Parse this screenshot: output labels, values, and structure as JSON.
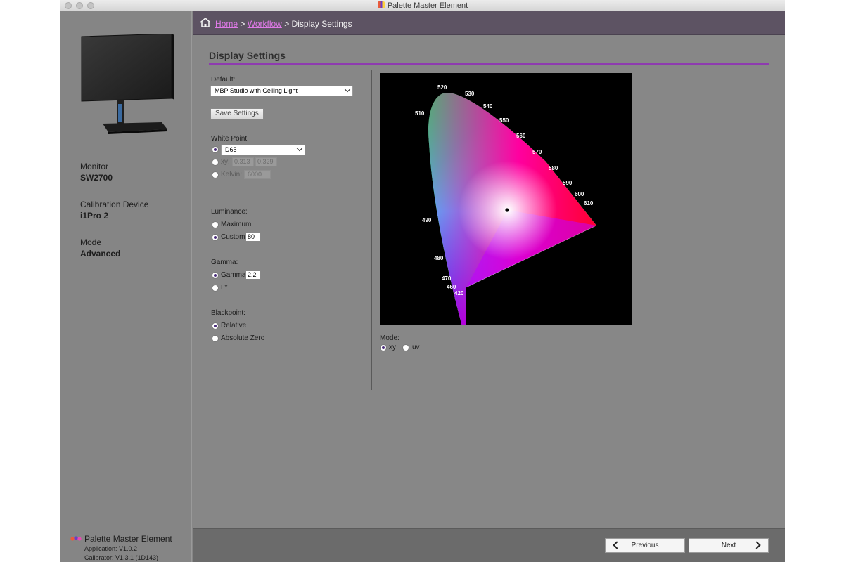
{
  "window": {
    "title": "Palette Master Element"
  },
  "breadcrumb": {
    "home": "Home",
    "workflow": "Workflow",
    "current": "Display Settings",
    "separator": ">"
  },
  "sidebar": {
    "monitor_label": "Monitor",
    "monitor_value": "SW2700",
    "device_label": "Calibration Device",
    "device_value": "i1Pro 2",
    "mode_label": "Mode",
    "mode_value": "Advanced",
    "brand_name": "Palette Master Element",
    "application_version": "Application: V1.0.2",
    "calibrator_version": "Calibrator: V1.3.1 (1D143)"
  },
  "main": {
    "page_title": "Display Settings",
    "default_label": "Default:",
    "default_value": "MBP Studio with Ceiling Light",
    "save_settings_label": "Save Settings",
    "white_point": {
      "label": "White Point:",
      "preset_value": "D65",
      "xy_label": "xy:",
      "x_value": "0.313",
      "y_value": "0.329",
      "kelvin_label": "Kelvin:",
      "kelvin_value": "6000",
      "selected": "preset"
    },
    "luminance": {
      "label": "Luminance:",
      "maximum_label": "Maximum",
      "custom_label": "Custom",
      "custom_value": "80",
      "selected": "custom"
    },
    "gamma": {
      "label": "Gamma:",
      "gamma_label": "Gamma",
      "gamma_value": "2.2",
      "lstar_label": "L*",
      "selected": "gamma"
    },
    "blackpoint": {
      "label": "Blackpoint:",
      "relative_label": "Relative",
      "absolute_label": "Absolute Zero",
      "selected": "relative"
    },
    "diagram": {
      "mode_label": "Mode:",
      "xy_label": "xy",
      "uv_label": "uv",
      "selected": "xy",
      "wavelength_labels": [
        "520",
        "530",
        "540",
        "550",
        "560",
        "570",
        "580",
        "590",
        "600",
        "610",
        "510",
        "490",
        "480",
        "470",
        "460",
        "420"
      ]
    }
  },
  "footer": {
    "previous_label": "Previous",
    "next_label": "Next"
  },
  "colors": {
    "header_bg": "#5d5363",
    "accent_purple": "#8e3bb0",
    "link_pink": "#e07ae8",
    "panel_gray": "#878787"
  }
}
